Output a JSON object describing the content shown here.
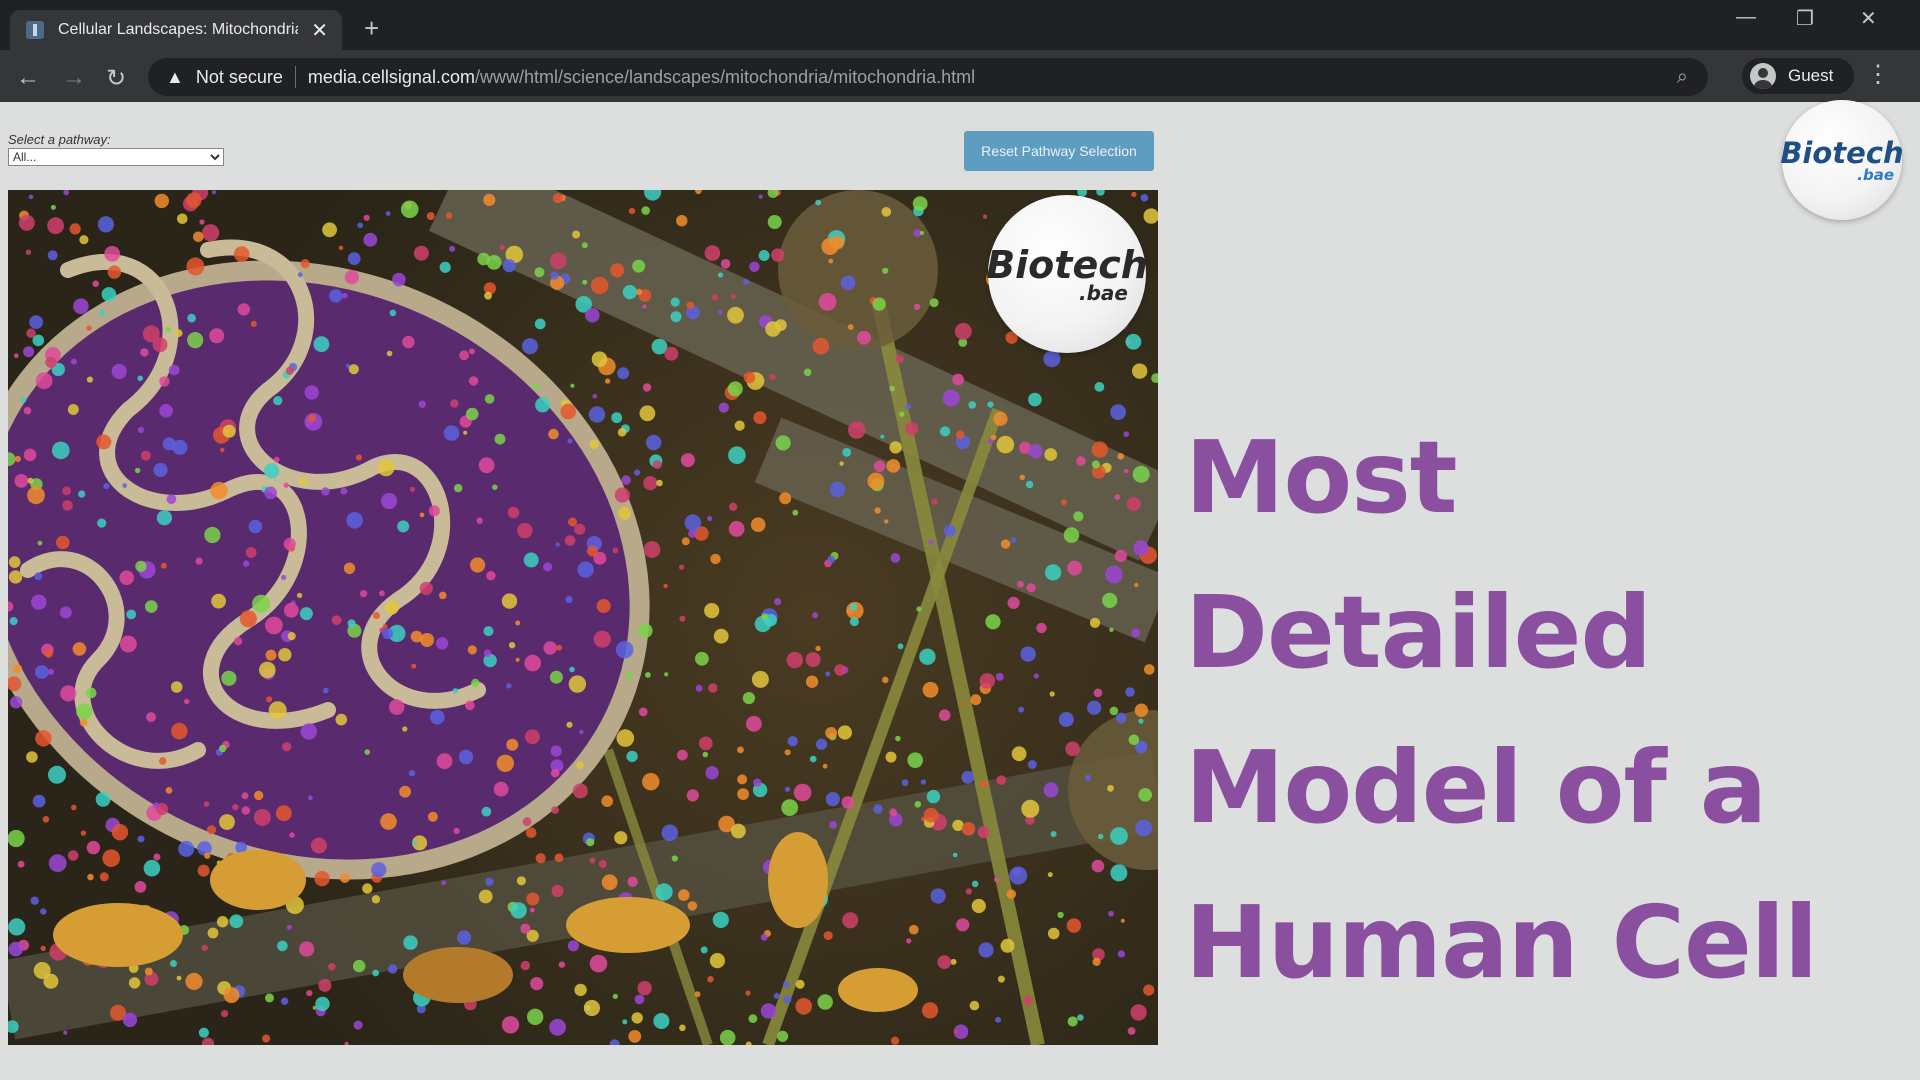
{
  "browser": {
    "tab_title": "Cellular Landscapes: Mitochondria",
    "new_tab": "+",
    "security_label": "Not secure",
    "url_host": "media.cellsignal.com",
    "url_path": "/www/html/science/landscapes/mitochondria/mitochondria.html",
    "profile_label": "Guest"
  },
  "page": {
    "pathway_label": "Select a pathway:",
    "pathway_selected": "All...",
    "reset_button": "Reset Pathway Selection"
  },
  "overlay": {
    "line1": "Most Detailed",
    "line2": "Model of a",
    "line3": "Human Cell"
  },
  "logo": {
    "main": "Biotech",
    "sub": ".bae",
    "colors": {
      "corner_main": "#1f4f87",
      "corner_sub": "#2f7ac2",
      "overlay_main": "#2a2a2a"
    }
  },
  "colors": {
    "headline": "#8a4f9e",
    "reset_button": "#5e9cc0",
    "chrome_dark": "#1f2124",
    "chrome_toolbar": "#35363a"
  }
}
